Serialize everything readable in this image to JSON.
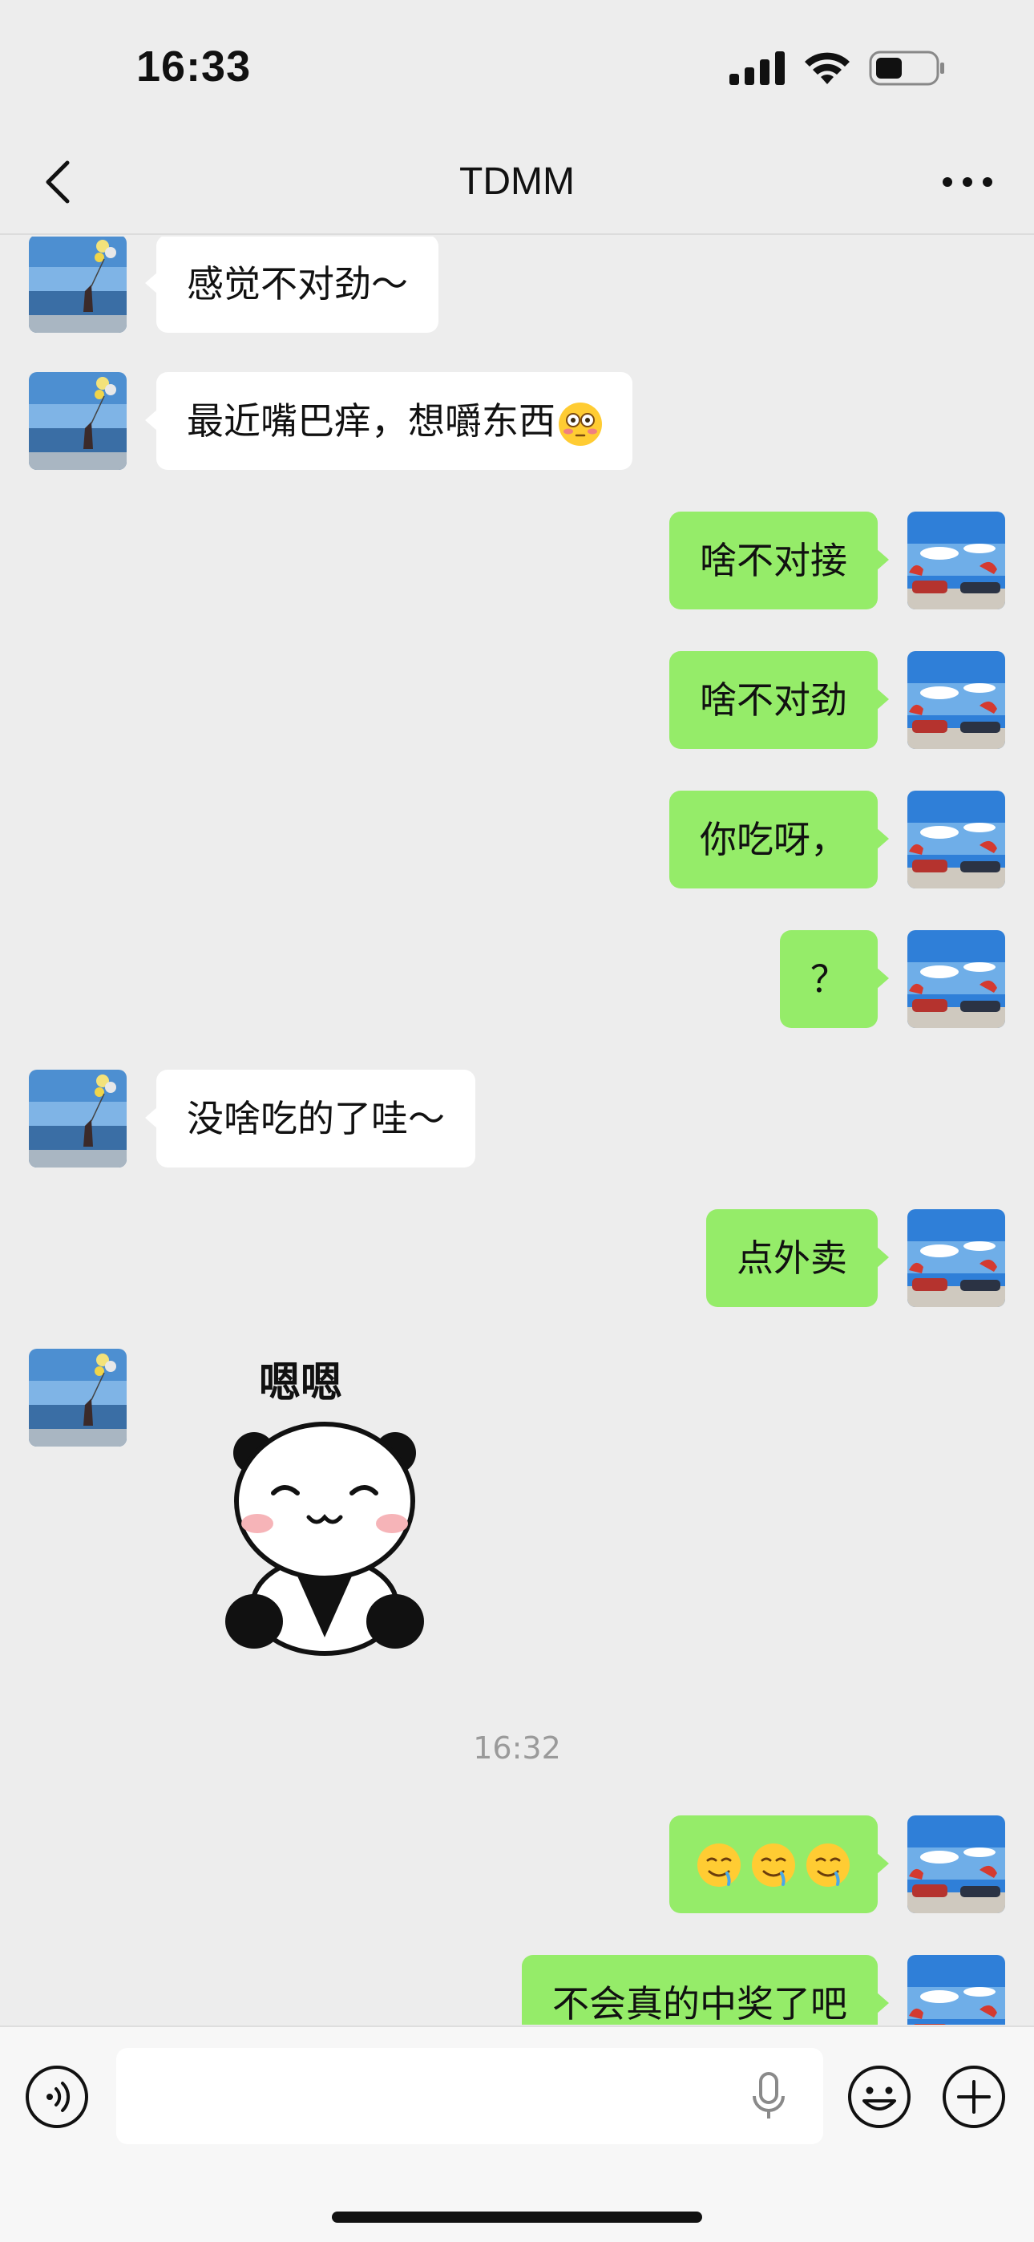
{
  "status": {
    "time": "16:33"
  },
  "header": {
    "title": "TDMM"
  },
  "messages": [
    {
      "side": "left",
      "text": "感觉不对劲～"
    },
    {
      "side": "left",
      "text": "最近嘴巴痒，想嚼东西"
    },
    {
      "side": "right",
      "text": "啥不对接"
    },
    {
      "side": "right",
      "text": "啥不对劲"
    },
    {
      "side": "right",
      "text": "你吃呀，"
    },
    {
      "side": "right",
      "text": "？"
    },
    {
      "side": "left",
      "text": "没啥吃的了哇～"
    },
    {
      "side": "right",
      "text": "点外卖"
    },
    {
      "side": "left",
      "sticker_text": "嗯嗯"
    },
    {
      "timestamp": "16:32"
    },
    {
      "side": "right",
      "emoji": "drooling-face-x3"
    },
    {
      "side": "right",
      "text": "不会真的中奖了吧"
    }
  ],
  "colors": {
    "sent_bubble": "#95ec69",
    "received_bubble": "#ffffff",
    "background": "#ededed"
  },
  "icons": [
    "back-chevron-icon",
    "more-icon",
    "voice-icon",
    "microphone-icon",
    "emoji-icon",
    "plus-icon",
    "flushed-face-emoji",
    "drooling-face-emoji"
  ]
}
